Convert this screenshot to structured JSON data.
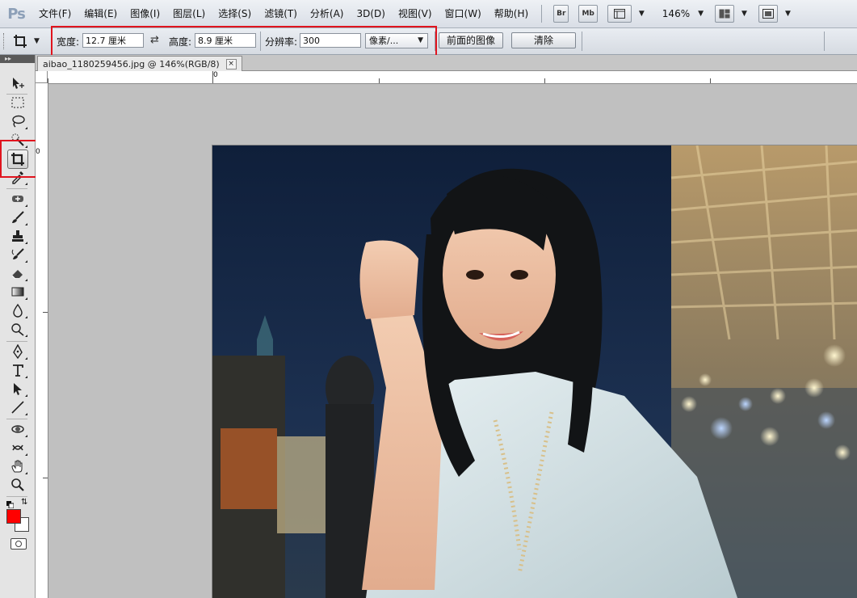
{
  "menubar": {
    "logo": "Ps",
    "items": [
      "文件(F)",
      "编辑(E)",
      "图像(I)",
      "图层(L)",
      "选择(S)",
      "滤镜(T)",
      "分析(A)",
      "3D(D)",
      "视图(V)",
      "窗口(W)",
      "帮助(H)"
    ],
    "bridge_label": "Br",
    "minibridge_label": "Mb",
    "zoom": "146%"
  },
  "options": {
    "width_label": "宽度:",
    "width_value": "12.7 厘米",
    "height_label": "高度:",
    "height_value": "8.9 厘米",
    "resolution_label": "分辨率:",
    "resolution_value": "300",
    "unit_value": "像素/...",
    "front_image_label": "前面的图像",
    "clear_label": "清除"
  },
  "document": {
    "tab_title": "aibao_1180259456.jpg @ 146%(RGB/8)",
    "close_glyph": "×",
    "ruler_top_zero": "0",
    "ruler_left_zero": "0"
  },
  "toolbox": {
    "header": "▸▸",
    "tools": [
      "move-tool",
      "marquee-tool",
      "lasso-tool",
      "quick-select-tool",
      "crop-tool",
      "eyedropper-tool",
      "healing-brush-tool",
      "brush-tool",
      "clone-stamp-tool",
      "history-brush-tool",
      "eraser-tool",
      "gradient-tool",
      "blur-tool",
      "dodge-tool",
      "pen-tool",
      "type-tool",
      "path-select-tool",
      "line-tool",
      "3d-rotate-tool",
      "3d-orbit-tool",
      "hand-tool",
      "zoom-tool"
    ],
    "active_tool": "crop-tool"
  },
  "colors": {
    "foreground": "#ff0000",
    "background": "#ffffff",
    "highlight_box": "#e0141e"
  }
}
